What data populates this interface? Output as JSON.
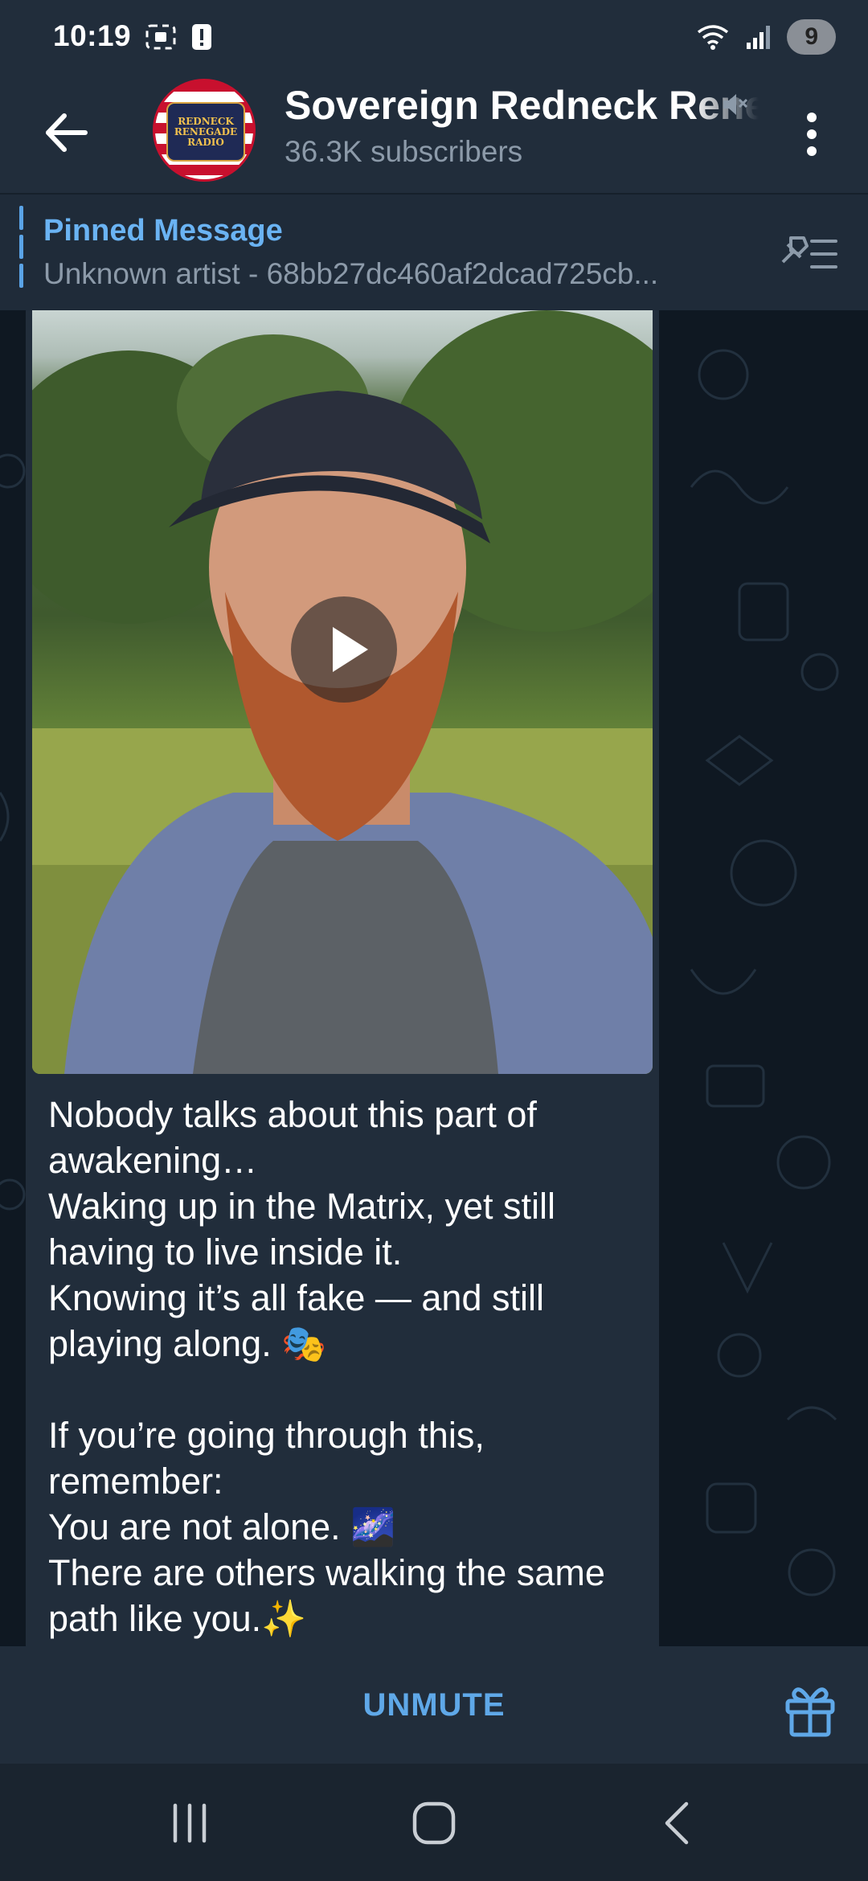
{
  "status_bar": {
    "time": "10:19",
    "notification_count": "9",
    "icons": [
      "screenshot-icon",
      "alert-icon",
      "wifi-icon",
      "signal-icon"
    ]
  },
  "header": {
    "channel_title": "Sovereign Redneck Renegade Radio",
    "subscribers": "36.3K subscribers",
    "avatar_text": "REDNECK RENEGADE",
    "avatar_subtext": "RADIO",
    "icons": [
      "back-arrow-icon",
      "muted-speaker-icon",
      "more-vertical-icon"
    ]
  },
  "pinned": {
    "title": "Pinned Message",
    "text": "Unknown artist - 68bb27dc460af2dcad725cb..."
  },
  "message": {
    "text": "Nobody talks about this part of awakening…\nWaking up in the Matrix, yet still having to live inside it.\nKnowing it’s all fake — and still playing along. 🎭\n\nIf you’re going through this, remember:\nYou are not alone. 🌌\nThere are others walking the same path like you.✨",
    "media": "video"
  },
  "bottom_bar": {
    "unmute_label": "UNMUTE",
    "icons": [
      "gift-icon"
    ]
  },
  "nav_bar": {
    "icons": [
      "recent-apps-icon",
      "home-icon",
      "back-icon"
    ]
  },
  "colors": {
    "accent": "#6ab3f3",
    "header_bg": "#212d3b",
    "chat_bg": "#0f1822",
    "secondary_text": "#8c9aa9"
  }
}
